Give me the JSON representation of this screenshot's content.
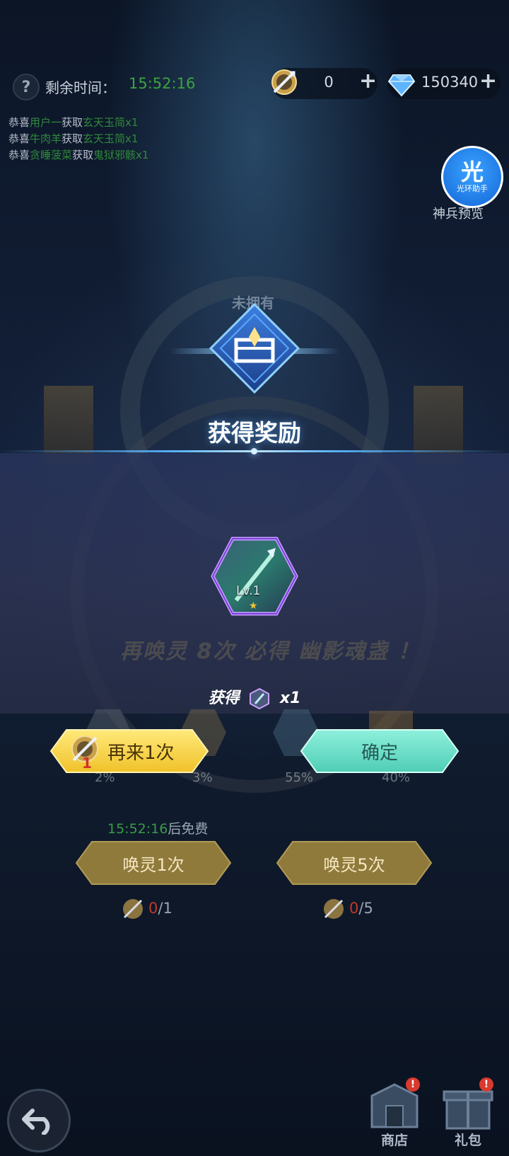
{
  "top_bar": {
    "help_label": "?",
    "time_label": "剩余时间：",
    "time_value": "15:52:16",
    "token_count": "0",
    "gem_count": "150340",
    "plus": "+"
  },
  "feed": [
    {
      "prefix": "恭喜",
      "name": "用户一",
      "mid": "获取",
      "item": "玄天玉简x1"
    },
    {
      "prefix": "恭喜",
      "name": "牛肉羊",
      "mid": "获取",
      "item": "玄天玉简x1"
    },
    {
      "prefix": "恭喜",
      "name": "贪睡菠菜",
      "mid": "获取",
      "item": "鬼狱邪骸x1"
    }
  ],
  "assistant": {
    "big": "光",
    "small": "光环助手",
    "preview": "神兵预览"
  },
  "background": {
    "unowned": "未拥有",
    "hint": "再唤灵 8次 必得 幽影魂盏 ！",
    "odds": [
      "2%",
      "3%",
      "55%",
      "40%"
    ],
    "free_time": "15:52:16",
    "free_suffix": "后免费",
    "summon_1": "唤灵1次",
    "summon_5": "唤灵5次",
    "cost_1": {
      "have": "0",
      "need": "/1"
    },
    "cost_5": {
      "have": "0",
      "need": "/5"
    }
  },
  "reward": {
    "title": "获得奖励",
    "item_level": "Lv.1",
    "obtain_prefix": "获得",
    "obtain_qty": "x1"
  },
  "actions": {
    "again_label": "再来1次",
    "again_badge": "1",
    "confirm_label": "确定"
  },
  "nav": {
    "shop": "商店",
    "gift": "礼包",
    "alert": "!"
  },
  "colors": {
    "time_green": "#3da33d",
    "gold": "#f2c230",
    "teal": "#4fcdb6",
    "reward_blue": "#5ab4ff"
  }
}
